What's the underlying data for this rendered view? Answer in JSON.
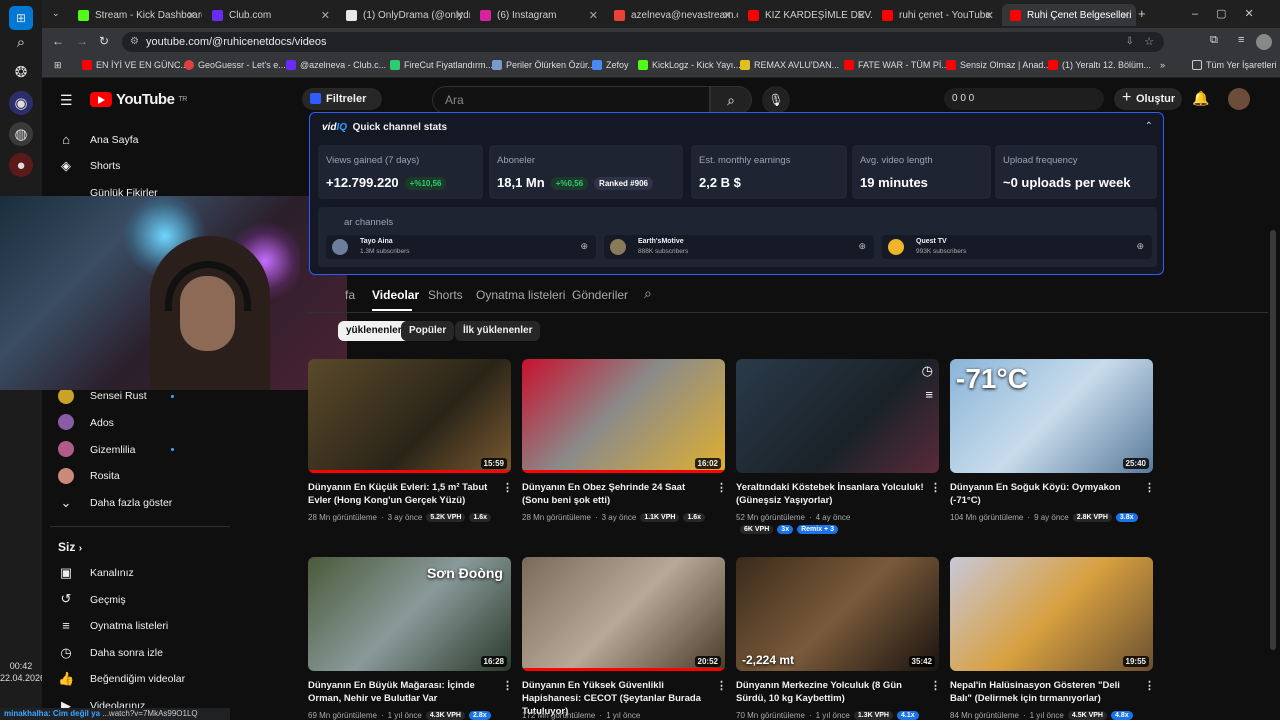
{
  "taskbar": {
    "time": "00:42",
    "date": "22.04.2026"
  },
  "tabs": [
    {
      "label": "Stream - Kick Dashboard",
      "color": "#53fc18"
    },
    {
      "label": "Club.com",
      "color": "#6a2cf5"
    },
    {
      "label": "(1) OnlyDrama (@onlydr...",
      "color": "#e8e8e8"
    },
    {
      "label": "(6) Instagram",
      "color": "#d6249f"
    },
    {
      "label": "azelneva@nevastream.c...",
      "color": "#ea4335"
    },
    {
      "label": "KIZ KARDEŞİMLE DEV...",
      "color": "#ff0000"
    },
    {
      "label": "ruhi çenet - YouTube",
      "color": "#ff0000"
    },
    {
      "label": "Ruhi Çenet Belgeselleri",
      "color": "#ff0000"
    }
  ],
  "address": "youtube.com/@ruhicenetdocs/videos",
  "bookmarks": [
    "EN İYİ VE EN GÜNC...",
    "GeoGuessr - Let's e...",
    "@azelneva - Club.c...",
    "FireCut Fiyatlandırm...",
    "Periler Ölürken Özür...",
    "Zefoy",
    "KickLogz - Kick Yayı...",
    "REMAX AVLU'DAN...",
    "FATE WAR - TÜM Pİ...",
    "Sensiz Olmaz | Anad...",
    "(1) Yeraltı 12. Bölüm...",
    "Tüm Yer İşaretleri"
  ],
  "youtube": {
    "logo": "YouTube",
    "country": "TR",
    "filters": "Filtreler",
    "search_placeholder": "Ara",
    "ext_counts": "0   0   0",
    "create": "Oluştur"
  },
  "sidebar": {
    "home": "Ana Sayfa",
    "shorts": "Shorts",
    "gunluk": "Günlük Fikirler",
    "channels": [
      {
        "name": "Sensei Rust",
        "color": "#c9a227",
        "dot": true
      },
      {
        "name": "Ados",
        "color": "#8a5ca8",
        "dot": false
      },
      {
        "name": "Gizemlilia",
        "color": "#b05b8a",
        "dot": true
      },
      {
        "name": "Rosita",
        "color": "#c88b7a",
        "dot": false
      }
    ],
    "more": "Daha fazla göster",
    "you": "Siz",
    "you_items": [
      "Kanalınız",
      "Geçmiş",
      "Oynatma listeleri",
      "Daha sonra izle",
      "Beğendiğim videolar",
      "Videolarınız"
    ]
  },
  "vidiq": {
    "title": "Quick channel stats",
    "stats": [
      {
        "label": "Views gained (7 days)",
        "value": "+12.799.220",
        "badge": "+%10,56"
      },
      {
        "label": "Aboneler",
        "value": "18,1 Mn",
        "badge": "+%0,56",
        "rank": "Ranked #906"
      },
      {
        "label": "Est. monthly earnings",
        "value": "2,2 B $"
      },
      {
        "label": "Avg. video length",
        "value": "19 minutes"
      },
      {
        "label": "Upload frequency",
        "value": "~0 uploads per week"
      }
    ],
    "similar_label": "ar channels",
    "similar": [
      {
        "name": "Tayo Aina",
        "subs": "1.3M subscribers",
        "color": "#6b7f9a"
      },
      {
        "name": "Earth'sMotive",
        "subs": "888K subscribers",
        "color": "#8a7a5a"
      },
      {
        "name": "Quest TV",
        "subs": "993K subscribers",
        "color": "#f0b429"
      }
    ]
  },
  "channel_tabs": [
    "fa",
    "Videolar",
    "Shorts",
    "Oynatma listeleri",
    "Gönderiler"
  ],
  "chips": [
    "yüklenenler",
    "Popüler",
    "İlk yüklenenler"
  ],
  "videos": [
    {
      "title": "Dünyanın En Küçük Evleri: 1,5 m² Tabut Evler (Hong Kong'un Gerçek Yüzü)",
      "views": "28 Mn görüntüleme",
      "age": "3 ay önce",
      "vph": "5.2K VPH",
      "mult": "1.6x",
      "duration": "15:59",
      "bg": "linear-gradient(135deg,#5a4a2a,#2a2418 60%,#7a5a30)",
      "progress": 100
    },
    {
      "title": "Dünyanın En Obez Şehrinde 24 Saat (Sonu beni şok etti)",
      "views": "28 Mn görüntüleme",
      "age": "3 ay önce",
      "vph": "1.1K VPH",
      "mult": "1.6x",
      "duration": "16:02",
      "bg": "linear-gradient(135deg,#c8102e,#8a8a8a 45%,#e0b030)",
      "progress": 100
    },
    {
      "title": "Yeraltındaki Köstebek İnsanlara Yolculuk! (Güneşsiz Yaşıyorlar)",
      "views": "52 Mn görüntüleme",
      "age": "4 ay önce",
      "vph": "6K VPH",
      "mult": "3x",
      "remix": "Remix + 3",
      "duration": "",
      "bg": "linear-gradient(135deg,#2a3a4a,#1a2228 60%,#5a2a3a)",
      "progress": 0
    },
    {
      "title": "Dünyanın En Soğuk Köyü: Oymyakon (-71°C)",
      "views": "104 Mn görüntüleme",
      "age": "9 ay önce",
      "vph": "2.8K VPH",
      "mult": "3.8x",
      "duration": "25:40",
      "overlay": "-71°C",
      "bg": "linear-gradient(135deg,#8ab4d8,#c8dcec 50%,#5a7a9a)",
      "progress": 0
    },
    {
      "title": "Dünyanın En Büyük Mağarası: İçinde Orman, Nehir ve Bulutlar Var",
      "views": "69 Mn görüntüleme",
      "age": "1 yıl önce",
      "vph": "4.3K VPH",
      "mult": "2.8x",
      "duration": "16:28",
      "overlay": "Sơn Đoòng",
      "bg": "linear-gradient(135deg,#4a5a3a,#8a9a9a 50%,#2a3a2a)",
      "progress": 0
    },
    {
      "title": "Dünyanın En Yüksek Güvenlikli Hapishanesi: CECOT (Şeytanlar Burada Tutuluyor)",
      "views": "172 Mn görüntüleme",
      "age": "1 yıl önce",
      "vph": "",
      "mult": "",
      "duration": "20:52",
      "bg": "linear-gradient(135deg,#7a6a5a,#b8a898 50%,#4a3a2a)",
      "progress": 100
    },
    {
      "title": "Dünyanın Merkezine Yolculuk (8 Gün Sürdü, 10 kg Kaybettim)",
      "views": "70 Mn görüntüleme",
      "age": "1 yıl önce",
      "vph": "1.3K VPH",
      "mult": "4.1x",
      "duration": "35:42",
      "overlay": "-2,224 mt",
      "bg": "linear-gradient(135deg,#3a2a1a,#7a5a3a 50%,#1a1410)",
      "progress": 0
    },
    {
      "title": "Nepal'in Halüsinasyon Gösteren \"Deli Balı\" (Delirmek için tırmanıyorlar)",
      "views": "84 Mn görüntüleme",
      "age": "1 yıl önce",
      "vph": "4.5K VPH",
      "mult": "4.8x",
      "duration": "19:55",
      "bg": "linear-gradient(135deg,#c8c8d8,#d8a040 50%,#6a5030)",
      "progress": 0
    }
  ],
  "status_url": "...watch?v=7MkAs99O1LQ",
  "stream_overlay": "minakhalha: Cim değil ya"
}
